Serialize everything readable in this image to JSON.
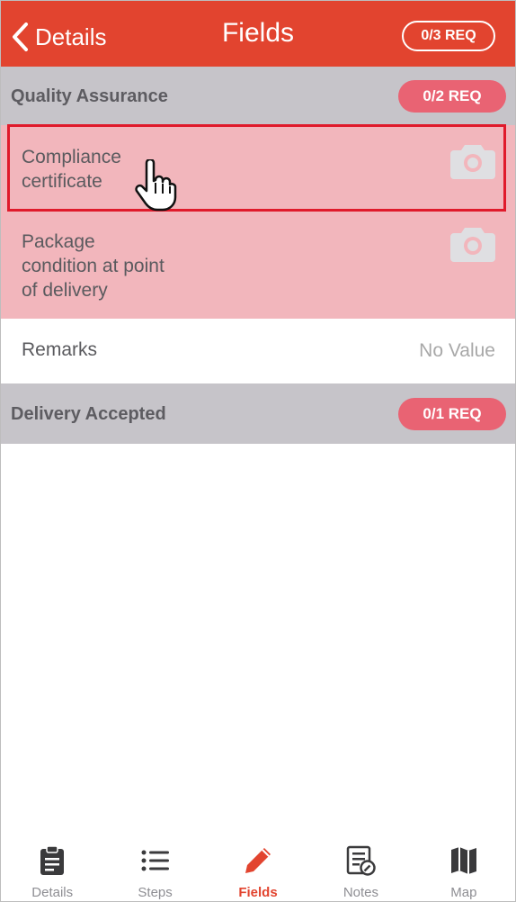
{
  "header": {
    "back_label": "Details",
    "title": "Fields",
    "badge": "0/3 REQ"
  },
  "sections": [
    {
      "title": "Quality Assurance",
      "req": "0/2 REQ",
      "rows": [
        {
          "label_lines": [
            "Compliance",
            "certificate"
          ],
          "type": "photo",
          "required": true
        },
        {
          "label_lines": [
            "Package",
            "condition at point",
            "of delivery"
          ],
          "type": "photo",
          "required": true
        },
        {
          "label": "Remarks",
          "value": "No Value",
          "required": false
        }
      ]
    },
    {
      "title": "Delivery Accepted",
      "req": "0/1 REQ",
      "rows": []
    }
  ],
  "tabs": [
    {
      "label": "Details",
      "icon": "clipboard-icon",
      "active": false
    },
    {
      "label": "Steps",
      "icon": "list-icon",
      "active": false
    },
    {
      "label": "Fields",
      "icon": "pencil-icon",
      "active": true
    },
    {
      "label": "Notes",
      "icon": "notes-icon",
      "active": false
    },
    {
      "label": "Map",
      "icon": "map-icon",
      "active": false
    }
  ],
  "colors": {
    "accent": "#e2442f",
    "req_pill": "#e96373",
    "required_row": "#f2b6bc",
    "section_bg": "#c6c4c9",
    "highlight_border": "#e01a2b"
  }
}
